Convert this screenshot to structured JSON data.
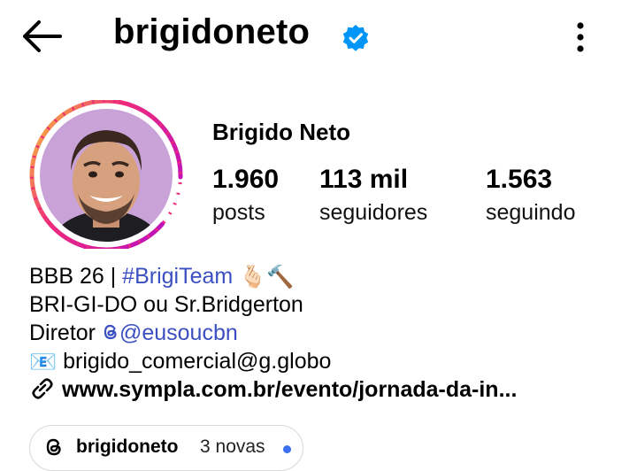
{
  "header": {
    "username": "brigidoneto",
    "verified": true,
    "icons": [
      "back-arrow-icon",
      "verified-badge-icon",
      "more-vertical-icon"
    ]
  },
  "profile": {
    "full_name": "Brigido Neto",
    "stats": [
      {
        "value": "1.960",
        "label": "posts"
      },
      {
        "value": "113 mil",
        "label": "seguidores"
      },
      {
        "value": "1.563",
        "label": "seguindo"
      }
    ],
    "story_ring_colors": [
      "#f9ce34",
      "#ee2a7b",
      "#c213b8"
    ]
  },
  "bio": {
    "line1_text": "BBB 26 | ",
    "line1_hashtag": "#BrigiTeam",
    "line1_emoji": "🫰🏻🔨",
    "line2": "BRI-GI-DO ou Sr.Bridgerton",
    "line3_text": "Diretor ",
    "line3_mention": "@eusoucbn",
    "line4_icon": "📧",
    "line4_text": "brigido_comercial@g.globo",
    "website": "www.sympla.com.br/evento/jornada-da-in..."
  },
  "threads": {
    "username": "brigidoneto",
    "new_count": "3 novas",
    "dot_color": "#3d6ff2"
  }
}
